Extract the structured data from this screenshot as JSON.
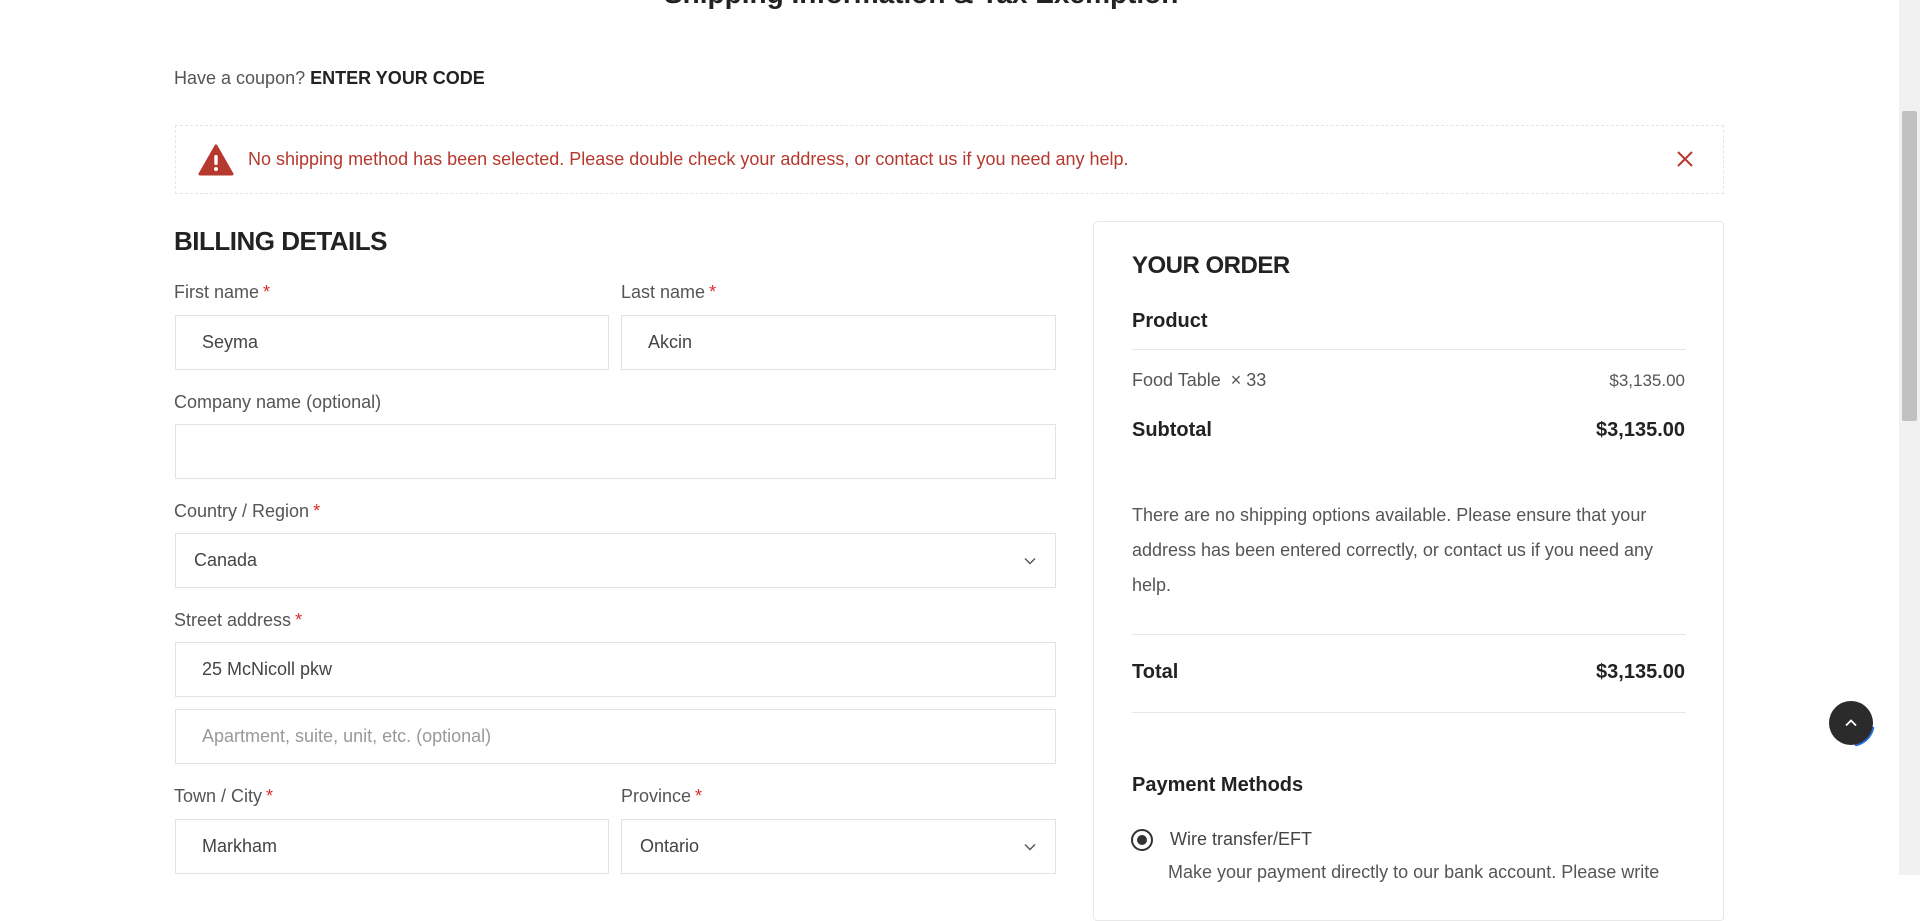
{
  "page": {
    "cut_heading": "Shipping Information & Tax Exemption"
  },
  "coupon": {
    "prompt": "Have a coupon?",
    "link": "ENTER YOUR CODE"
  },
  "notice": {
    "message": "No shipping method has been selected. Please double check your address, or contact us if you need any help.",
    "icon": "warning-icon",
    "close_icon": "close-icon",
    "color": "#b5392e"
  },
  "billing": {
    "heading": "BILLING DETAILS",
    "required_mark": "*",
    "first_name": {
      "label": "First name",
      "value": "Seyma"
    },
    "last_name": {
      "label": "Last name",
      "value": "Akcin"
    },
    "company": {
      "label": "Company name (optional)",
      "value": ""
    },
    "country": {
      "label": "Country / Region",
      "value": "Canada"
    },
    "street": {
      "label": "Street address",
      "value": "25 McNicoll pkw",
      "apartment_placeholder": "Apartment, suite, unit, etc. (optional)"
    },
    "city": {
      "label": "Town / City",
      "value": "Markham"
    },
    "province": {
      "label": "Province",
      "value": "Ontario"
    }
  },
  "order": {
    "heading": "YOUR ORDER",
    "product_header": "Product",
    "item": {
      "name": "Food Table",
      "qty": "× 33",
      "price": "$3,135.00"
    },
    "subtotal": {
      "label": "Subtotal",
      "value": "$3,135.00"
    },
    "shipping_note": "There are no shipping options available. Please ensure that your address has been entered correctly, or contact us if you need any help.",
    "total": {
      "label": "Total",
      "value": "$3,135.00"
    },
    "payment": {
      "heading": "Payment Methods",
      "method": "Wire transfer/EFT",
      "description": "Make your payment directly to our bank account. Please write"
    }
  },
  "colors": {
    "required": "#e02b27",
    "scroll_top_bg": "#2b2b2b",
    "progress_arc": "#2a6fdb"
  }
}
